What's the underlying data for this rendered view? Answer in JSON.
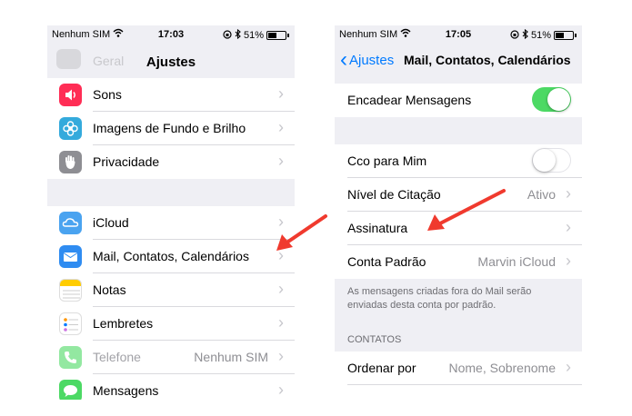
{
  "left": {
    "status": {
      "carrier": "Nenhum SIM",
      "time": "17:03",
      "battery": "51%",
      "battery_level": 0.51
    },
    "nav_title": "Ajustes",
    "ghost_label": "Geral",
    "rows": [
      {
        "label": "Sons",
        "icon": "speaker-icon",
        "color": "#ff2d55",
        "glyph": "🔊"
      },
      {
        "label": "Imagens de Fundo e Brilho",
        "icon": "flower-icon",
        "color": "#34aadc",
        "glyph": "✿"
      },
      {
        "label": "Privacidade",
        "icon": "hand-icon",
        "color": "#8e8e93",
        "glyph": "✋"
      },
      {
        "label": "iCloud",
        "icon": "cloud-icon",
        "color": "#4aa3f0",
        "glyph": "☁"
      },
      {
        "label": "Mail, Contatos, Calendários",
        "icon": "envelope-icon",
        "color": "#2f8cf1",
        "glyph": "✉"
      },
      {
        "label": "Notas",
        "icon": "notes-icon",
        "color": "#ffcc00",
        "glyph": "≡"
      },
      {
        "label": "Lembretes",
        "icon": "list-icon",
        "color": "#ffffff",
        "glyph": "⋮"
      },
      {
        "label": "Telefone",
        "icon": "phone-icon",
        "color": "#4cd964",
        "glyph": "✆",
        "value": "Nenhum SIM"
      },
      {
        "label": "Mensagens",
        "icon": "message-icon",
        "color": "#4cd964",
        "glyph": "💬"
      }
    ]
  },
  "right": {
    "status": {
      "carrier": "Nenhum SIM",
      "time": "17:05",
      "battery": "51%",
      "battery_level": 0.51
    },
    "back_label": "Ajustes",
    "nav_title": "Mail, Contatos, Calendários",
    "rows": {
      "encadear": {
        "label": "Encadear Mensagens",
        "toggle": "on"
      },
      "cco": {
        "label": "Cco para Mim",
        "toggle": "off"
      },
      "citacao": {
        "label": "Nível de Citação",
        "value": "Ativo"
      },
      "assinatura": {
        "label": "Assinatura"
      },
      "conta": {
        "label": "Conta Padrão",
        "value": "Marvin iCloud"
      },
      "ordenar": {
        "label": "Ordenar por",
        "value": "Nome, Sobrenome"
      }
    },
    "footer_note": "As mensagens criadas fora do Mail serão enviadas desta conta por padrão.",
    "section_contatos": "CONTATOS"
  },
  "colors": {
    "accent": "#007aff",
    "toggle_on": "#4cd964",
    "arrow": "#f03a2e"
  }
}
